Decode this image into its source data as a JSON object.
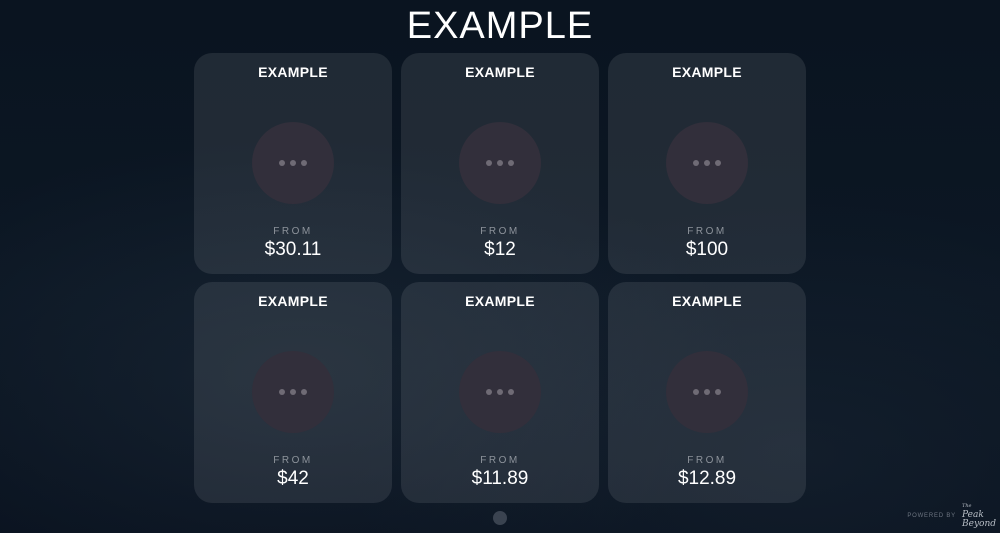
{
  "page": {
    "title": "EXAMPLE"
  },
  "cards": [
    {
      "name": "EXAMPLE",
      "icon": "more-dots-icon",
      "from_label": "FROM",
      "price": "$30.11"
    },
    {
      "name": "EXAMPLE",
      "icon": "more-dots-icon",
      "from_label": "FROM",
      "price": "$12"
    },
    {
      "name": "EXAMPLE",
      "icon": "more-dots-icon",
      "from_label": "FROM",
      "price": "$100"
    },
    {
      "name": "EXAMPLE",
      "icon": "more-dots-icon",
      "from_label": "FROM",
      "price": "$42"
    },
    {
      "name": "EXAMPLE",
      "icon": "more-dots-icon",
      "from_label": "FROM",
      "price": "$11.89"
    },
    {
      "name": "EXAMPLE",
      "icon": "more-dots-icon",
      "from_label": "FROM",
      "price": "$12.89"
    }
  ],
  "pagination": {
    "current_page": 1,
    "total_pages": 1
  },
  "footer": {
    "powered_by": "POWERED BY",
    "brand": {
      "line1": "The",
      "line2": "Peak",
      "line3": "Beyond"
    }
  },
  "colors": {
    "background": "#0b1521",
    "card": "rgba(255,255,255,0.09)",
    "icon_circle": "#322f3b",
    "muted_text": "#8d939b"
  }
}
